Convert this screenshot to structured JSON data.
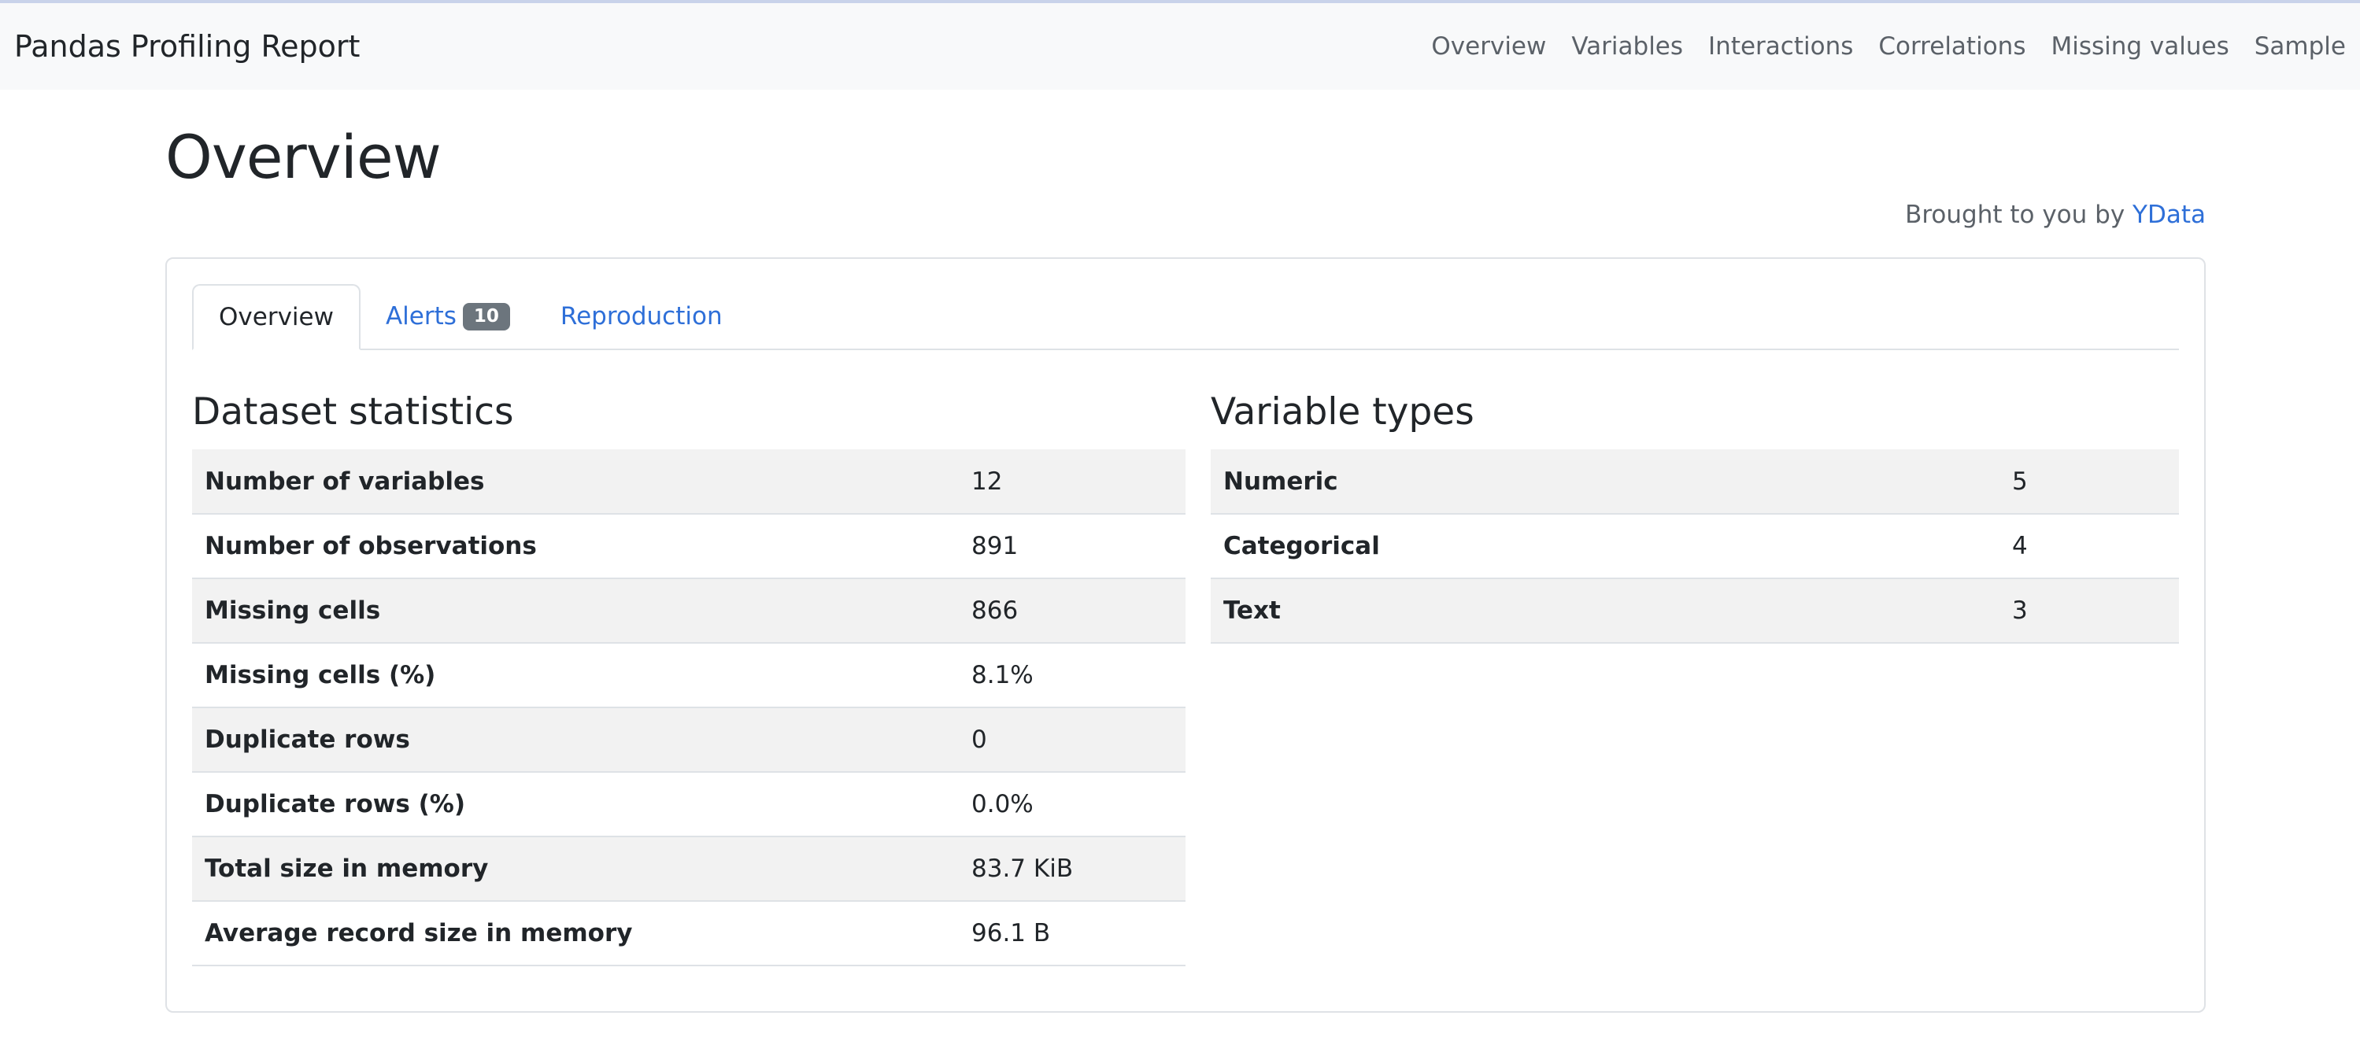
{
  "navbar": {
    "brand": "Pandas Profiling Report",
    "links": [
      "Overview",
      "Variables",
      "Interactions",
      "Correlations",
      "Missing values",
      "Sample"
    ]
  },
  "page": {
    "title": "Overview",
    "credit_prefix": "Brought to you by ",
    "credit_link": "YData"
  },
  "tabs": {
    "overview": "Overview",
    "alerts": "Alerts",
    "alerts_count": "10",
    "reproduction": "Reproduction"
  },
  "dataset_statistics": {
    "title": "Dataset statistics",
    "rows": [
      {
        "label": "Number of variables",
        "value": "12"
      },
      {
        "label": "Number of observations",
        "value": "891"
      },
      {
        "label": "Missing cells",
        "value": "866"
      },
      {
        "label": "Missing cells (%)",
        "value": "8.1%"
      },
      {
        "label": "Duplicate rows",
        "value": "0"
      },
      {
        "label": "Duplicate rows (%)",
        "value": "0.0%"
      },
      {
        "label": "Total size in memory",
        "value": "83.7 KiB"
      },
      {
        "label": "Average record size in memory",
        "value": "96.1 B"
      }
    ]
  },
  "variable_types": {
    "title": "Variable types",
    "rows": [
      {
        "label": "Numeric",
        "value": "5"
      },
      {
        "label": "Categorical",
        "value": "4"
      },
      {
        "label": "Text",
        "value": "3"
      }
    ]
  }
}
